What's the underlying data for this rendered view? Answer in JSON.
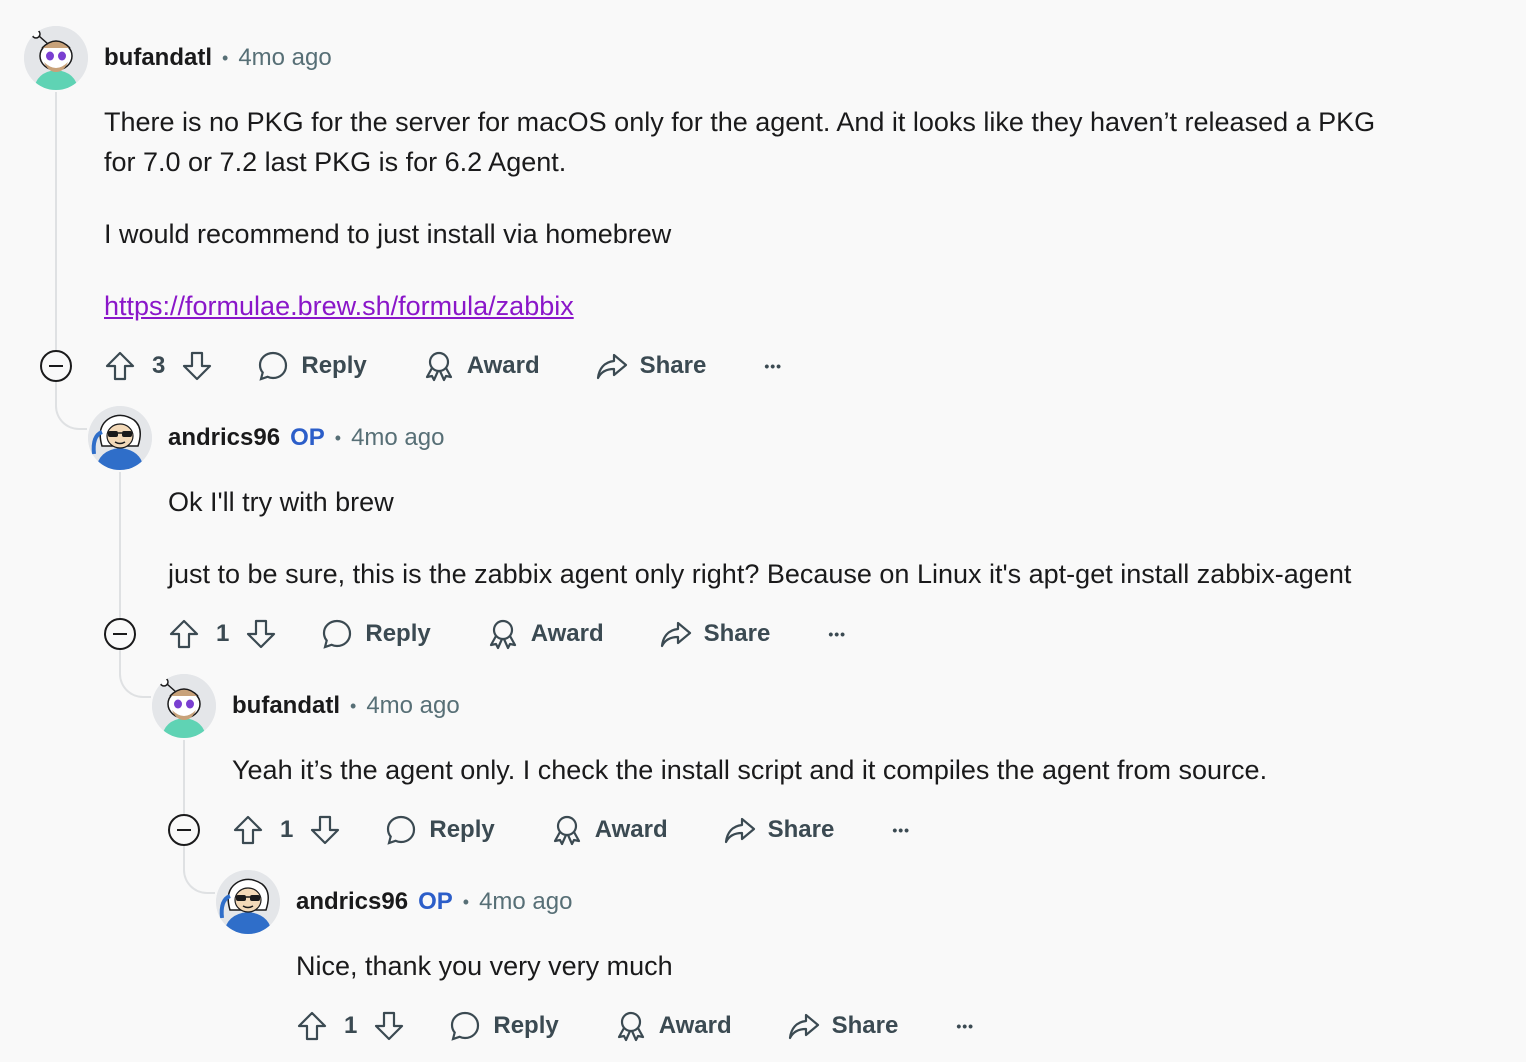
{
  "comments": [
    {
      "username": "bufandatl",
      "op": false,
      "time": "4mo ago",
      "paragraphs": [
        "There is no PKG for the server for macOS only for the agent. And it looks like they haven’t released a PKG",
        "for 7.0 or 7.2 last PKG is for 6.2 Agent.",
        "I would recommend to just install via homebrew"
      ],
      "link": "https://formulae.brew.sh/formula/zabbix",
      "votes": "3"
    },
    {
      "username": "andrics96",
      "op": true,
      "op_label": "OP",
      "time": "4mo ago",
      "paragraphs": [
        "Ok I'll try with brew",
        "just to be sure, this is the zabbix agent only right? Because on Linux it's apt-get install zabbix-agent"
      ],
      "votes": "1"
    },
    {
      "username": "bufandatl",
      "op": false,
      "time": "4mo ago",
      "paragraphs": [
        "Yeah it’s the agent only. I check the install script and it compiles the agent from source."
      ],
      "votes": "1"
    },
    {
      "username": "andrics96",
      "op": true,
      "op_label": "OP",
      "time": "4mo ago",
      "paragraphs": [
        "Nice, thank you very very much"
      ],
      "votes": "1"
    }
  ],
  "actions": {
    "reply": "Reply",
    "award": "Award",
    "share": "Share",
    "more": "•••",
    "separator": "•"
  },
  "colors": {
    "op_accent": "#2c5ec9",
    "link": "#8a16c9",
    "thread_line": "#dfe1e3",
    "meta_text": "#576f76"
  },
  "icons": [
    "upvote-icon",
    "downvote-icon",
    "reply-bubble-icon",
    "award-icon",
    "share-icon",
    "collapse-icon",
    "more-icon"
  ]
}
